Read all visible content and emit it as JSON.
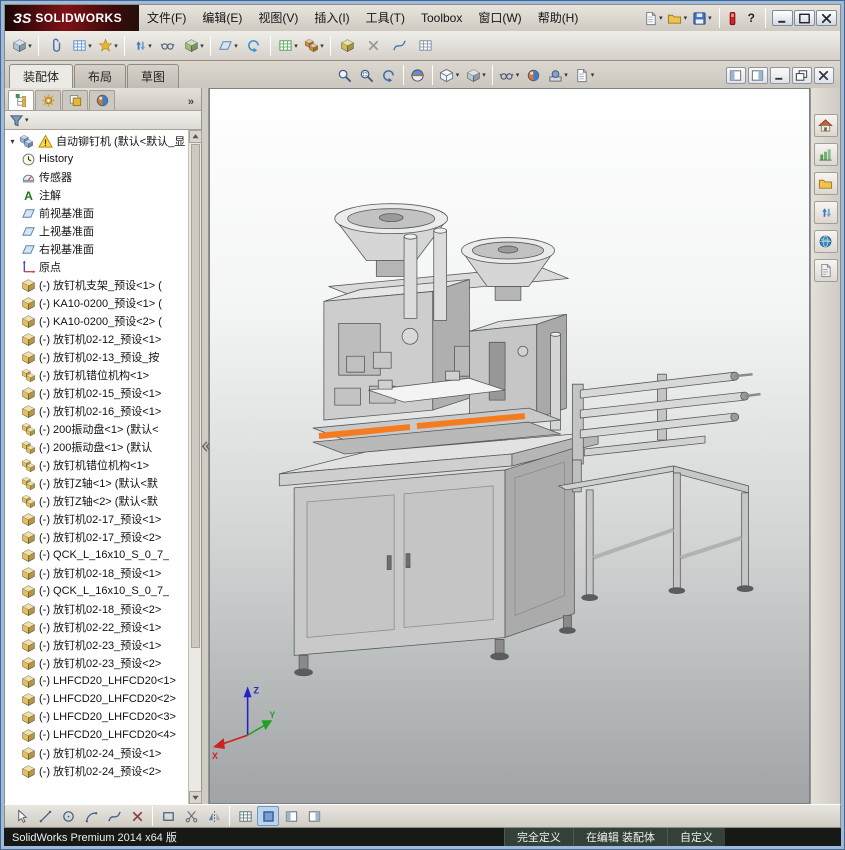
{
  "titlebar": {
    "logo_prefix": "ЗS",
    "logo_text": "SOLIDWORKS",
    "menus": [
      "文件(F)",
      "编辑(E)",
      "视图(V)",
      "插入(I)",
      "工具(T)",
      "Toolbox",
      "窗口(W)",
      "帮助(H)"
    ],
    "quick_icons": [
      {
        "name": "new-document",
        "shape": "page",
        "color": "#e8e8e8",
        "dd": true
      },
      {
        "name": "open-document",
        "shape": "folder",
        "color": "#f2c14e",
        "dd": true
      },
      {
        "name": "save-document",
        "shape": "floppy",
        "color": "#3f6fbf",
        "dd": true
      }
    ],
    "help_label": "?",
    "window_buttons": [
      {
        "name": "minimize-window",
        "shape": "minus",
        "color": "#223"
      },
      {
        "name": "maximize-window",
        "shape": "box",
        "color": "#223"
      },
      {
        "name": "close-window",
        "shape": "xmark",
        "color": "#223"
      }
    ]
  },
  "toolbar": {
    "icons": [
      {
        "name": "insert-components",
        "shape": "cube",
        "color": "#a9c4da",
        "dd": true
      },
      {
        "name": "mate",
        "shape": "clip",
        "color": "#4a6fae",
        "sep": true
      },
      {
        "name": "linear-component-pattern",
        "shape": "gridc",
        "color": "#5588cc",
        "dd": true
      },
      {
        "name": "smart-fasteners",
        "shape": "star",
        "color": "#eab62a",
        "dd": true
      },
      {
        "name": "move-component",
        "shape": "updown",
        "color": "#3d7ec2",
        "dd": true,
        "sep": true
      },
      {
        "name": "show-hidden-components",
        "shape": "glasses",
        "color": "#55627f"
      },
      {
        "name": "assembly-features",
        "shape": "cube",
        "color": "#9cbf77",
        "dd": true
      },
      {
        "name": "reference-geometry",
        "shape": "plane",
        "color": "#5b84b0",
        "dd": true,
        "sep": true
      },
      {
        "name": "new-motion-study",
        "shape": "arrowc",
        "color": "#3a8fd4"
      },
      {
        "name": "bill-of-materials",
        "shape": "gridc",
        "color": "#4d9e4d",
        "dd": true,
        "sep": true
      },
      {
        "name": "exploded-view",
        "shape": "cubes",
        "color": "#d08a2e",
        "dd": true
      },
      {
        "name": "instant3d",
        "shape": "cube",
        "color": "#d3bd4e",
        "sep": true
      },
      {
        "name": "mate-diagnostics",
        "shape": "xmark",
        "color": "#999999"
      },
      {
        "name": "spline-tools",
        "shape": "spline",
        "color": "#3f6fbf"
      },
      {
        "name": "measure",
        "shape": "gridc",
        "color": "#7a8aa0"
      }
    ]
  },
  "tabs": {
    "items": [
      "装配体",
      "布局",
      "草图"
    ],
    "active": 0
  },
  "headsup": {
    "items": [
      {
        "name": "zoom-to-fit",
        "shape": "magnifier",
        "color": "#3c5c84"
      },
      {
        "name": "zoom-to-area",
        "shape": "magarea",
        "color": "#3c5c84"
      },
      {
        "name": "previous-view",
        "shape": "arrowc",
        "color": "#3a6fb0"
      },
      {
        "name": "section-view",
        "shape": "section",
        "color": "#5b8dd9",
        "sep": true
      },
      {
        "name": "view-orientation",
        "shape": "cubeo",
        "color": "#667788",
        "dd": true,
        "sep": true
      },
      {
        "name": "display-style",
        "shape": "cube",
        "color": "#b9c6d2",
        "dd": true
      },
      {
        "name": "hide-show-items",
        "shape": "glasses",
        "color": "#4a5a7a",
        "dd": true,
        "sep": true
      },
      {
        "name": "edit-appearance",
        "shape": "ball2",
        "color": "#d9773a"
      },
      {
        "name": "apply-scene",
        "shape": "scene",
        "color": "#7fa3d0",
        "dd": true
      },
      {
        "name": "view-settings",
        "shape": "page",
        "color": "#8899aa",
        "dd": true
      }
    ]
  },
  "docwin": {
    "buttons": [
      {
        "name": "pane-left",
        "shape": "boxl",
        "color": "#667"
      },
      {
        "name": "pane-right",
        "shape": "boxr",
        "color": "#667"
      },
      {
        "name": "minimize-document",
        "shape": "minus",
        "color": "#334"
      },
      {
        "name": "restore-document",
        "shape": "overlap",
        "color": "#334"
      },
      {
        "name": "close-document",
        "shape": "xmark",
        "color": "#334"
      }
    ]
  },
  "panel": {
    "tabs": [
      {
        "name": "featuremanager-tree",
        "shape": "treeicon",
        "color": "#4a9e4a",
        "pressed": true
      },
      {
        "name": "propertymanager",
        "shape": "gear",
        "color": "#d9a53a"
      },
      {
        "name": "configurationmanager",
        "shape": "layers",
        "color": "#e0b83a"
      },
      {
        "name": "displaymanager",
        "shape": "ball2",
        "color": "#cc7a3a"
      }
    ],
    "overflow": "»",
    "filter": {
      "name": "tree-filter",
      "shape": "funnel",
      "color": "#7a97c9",
      "dd": true
    }
  },
  "tree": {
    "items": [
      {
        "label": "自动铆钉机 (默认<默认_显",
        "icon": "root",
        "root": true,
        "warn": true
      },
      {
        "label": "History",
        "icon": "history"
      },
      {
        "label": "传感器",
        "icon": "sensors"
      },
      {
        "label": "注解",
        "icon": "annotations"
      },
      {
        "label": "前视基准面",
        "icon": "plane"
      },
      {
        "label": "上视基准面",
        "icon": "plane"
      },
      {
        "label": "右视基准面",
        "icon": "plane"
      },
      {
        "label": "原点",
        "icon": "origin"
      },
      {
        "label": "(-) 放钉机支架_预设<1> (",
        "icon": "part"
      },
      {
        "label": "(-) KA10-0200_预设<1> (",
        "icon": "part"
      },
      {
        "label": "(-) KA10-0200_预设<2> (",
        "icon": "part"
      },
      {
        "label": "(-) 放钉机02-12_预设<1>",
        "icon": "part"
      },
      {
        "label": "(-) 放钉机02-13_预设_按",
        "icon": "part"
      },
      {
        "label": "(-) 放钉机错位机构<1>",
        "icon": "assembly"
      },
      {
        "label": "(-) 放钉机02-15_预设<1>",
        "icon": "part"
      },
      {
        "label": "(-) 放钉机02-16_预设<1>",
        "icon": "part"
      },
      {
        "label": "(-) 200振动盘<1> (默认<",
        "icon": "assembly"
      },
      {
        "label": "(-) 200振动盘<1> (默认",
        "icon": "assembly"
      },
      {
        "label": "(-) 放钉机错位机构<1>",
        "icon": "assembly"
      },
      {
        "label": "(-) 放钉Z轴<1> (默认<默",
        "icon": "assembly"
      },
      {
        "label": "(-) 放钉Z轴<2> (默认<默",
        "icon": "assembly"
      },
      {
        "label": "(-) 放钉机02-17_预设<1>",
        "icon": "part"
      },
      {
        "label": "(-) 放钉机02-17_预设<2>",
        "icon": "part"
      },
      {
        "label": "(-) QCK_L_16x10_S_0_7_",
        "icon": "part"
      },
      {
        "label": "(-) 放钉机02-18_预设<1>",
        "icon": "part"
      },
      {
        "label": "(-) QCK_L_16x10_S_0_7_",
        "icon": "part"
      },
      {
        "label": "(-) 放钉机02-18_预设<2>",
        "icon": "part"
      },
      {
        "label": "(-) 放钉机02-22_预设<1>",
        "icon": "part"
      },
      {
        "label": "(-) 放钉机02-23_预设<1>",
        "icon": "part"
      },
      {
        "label": "(-) 放钉机02-23_预设<2>",
        "icon": "part"
      },
      {
        "label": "(-) LHFCD20_LHFCD20<1>",
        "icon": "part"
      },
      {
        "label": "(-) LHFCD20_LHFCD20<2>",
        "icon": "part"
      },
      {
        "label": "(-) LHFCD20_LHFCD20<3>",
        "icon": "part"
      },
      {
        "label": "(-) LHFCD20_LHFCD20<4>",
        "icon": "part"
      },
      {
        "label": "(-) 放钉机02-24_预设<1>",
        "icon": "part"
      },
      {
        "label": "(-) 放钉机02-24_预设<2>",
        "icon": "part"
      }
    ]
  },
  "viewport": {
    "triad": {
      "x": "X",
      "y": "Y",
      "z": "Z"
    },
    "highlight_color": "#f47b20"
  },
  "taskpane": {
    "items": [
      {
        "name": "solidworks-resources",
        "shape": "house",
        "color": "#c8622f"
      },
      {
        "name": "design-library",
        "shape": "chart",
        "color": "#4d9e4d"
      },
      {
        "name": "file-explorer",
        "shape": "folder",
        "color": "#f2c14e"
      },
      {
        "name": "view-palette",
        "shape": "updown",
        "color": "#3d7ec2"
      },
      {
        "name": "appearances-scenes",
        "shape": "globe",
        "color": "#3a86c8"
      },
      {
        "name": "custom-properties",
        "shape": "doc",
        "color": "#9aa4ae"
      }
    ]
  },
  "sketchbar": {
    "items": [
      {
        "name": "select",
        "shape": "cursor",
        "color": "#556"
      },
      {
        "name": "line",
        "shape": "line",
        "color": "#3c5c84"
      },
      {
        "name": "circle",
        "shape": "circleO",
        "color": "#3c5c84"
      },
      {
        "name": "arc",
        "shape": "arc",
        "color": "#3c5c84"
      },
      {
        "name": "spline",
        "shape": "spline",
        "color": "#3c5c84"
      },
      {
        "name": "point",
        "shape": "xmark",
        "color": "#8a4444"
      },
      {
        "name": "corner-rectangle",
        "shape": "rectO",
        "color": "#3c5c84",
        "sep": true
      },
      {
        "name": "trim-entities",
        "shape": "scissors",
        "color": "#667"
      },
      {
        "name": "mirror-entities",
        "shape": "mirror",
        "color": "#3c5c84"
      },
      {
        "name": "grid-snap",
        "shape": "gridc",
        "color": "#55707f",
        "sep": true
      },
      {
        "name": "shaded-sketch-contours",
        "shape": "shadedbox",
        "color": "#4d7fc4",
        "pressed": true
      },
      {
        "name": "section-display",
        "shape": "boxl",
        "color": "#556"
      },
      {
        "name": "pane-display",
        "shape": "boxr",
        "color": "#556"
      }
    ]
  },
  "statusbar": {
    "left": "SolidWorks Premium 2014 x64 版",
    "defined": "完全定义",
    "editing": "在编辑 装配体",
    "custom": "自定义"
  }
}
